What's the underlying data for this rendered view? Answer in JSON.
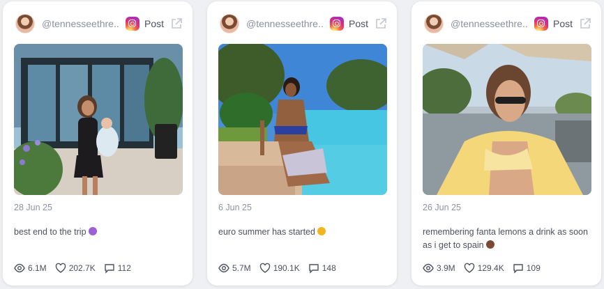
{
  "posts": [
    {
      "handle": "@tennesseethre...",
      "platform_label": "Post",
      "date": "28 Jun 25",
      "caption": "best end to the trip",
      "caption_emoji": "purple-heart-face",
      "views": "6.1M",
      "likes": "202.7K",
      "comments": "112"
    },
    {
      "handle": "@tennesseethre...",
      "platform_label": "Post",
      "date": "6 Jun 25",
      "caption": "euro summer has started",
      "caption_emoji": "sun",
      "views": "5.7M",
      "likes": "190.1K",
      "comments": "148"
    },
    {
      "handle": "@tennesseethre...",
      "platform_label": "Post",
      "date": "26 Jun 25",
      "caption": "remembering fanta lemons a drink as soon as i get to spain",
      "caption_emoji": "brown-heart",
      "views": "3.9M",
      "likes": "129.4K",
      "comments": "109"
    }
  ],
  "colors": {
    "background": "#eef0f3",
    "card": "#ffffff",
    "muted_text": "#8d93a3",
    "text": "#4b5160"
  }
}
